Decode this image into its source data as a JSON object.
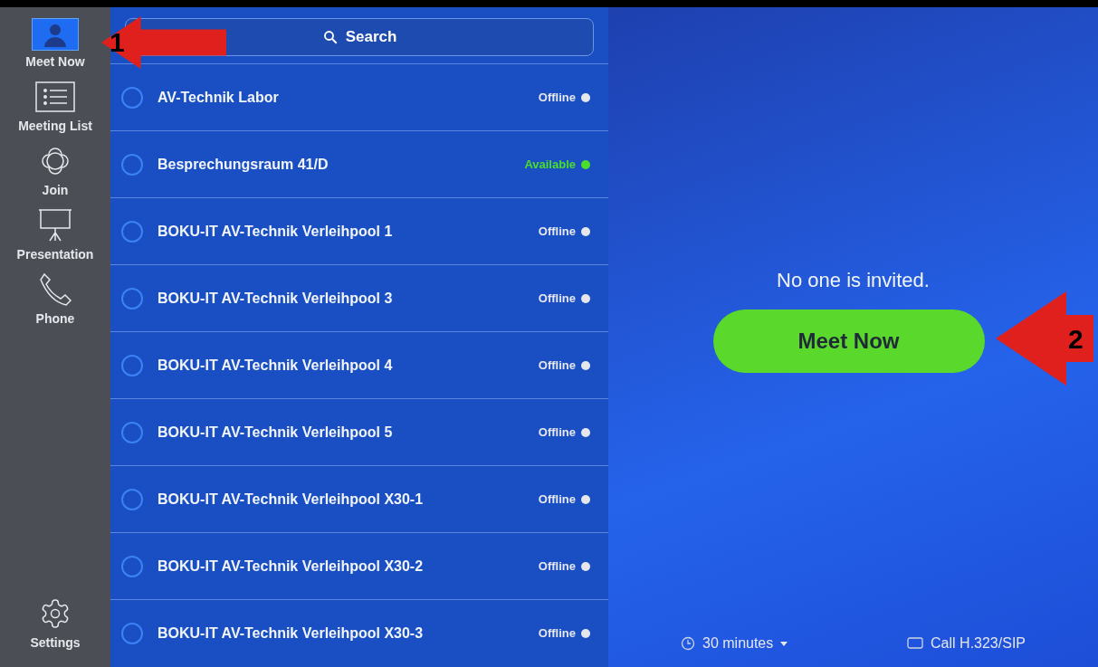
{
  "sidebar": {
    "items": [
      {
        "kind": "person",
        "label": "Meet Now",
        "selected": true
      },
      {
        "kind": "list",
        "label": "Meeting List",
        "selected": false
      },
      {
        "kind": "join",
        "label": "Join",
        "selected": false
      },
      {
        "kind": "presentation",
        "label": "Presentation",
        "selected": false
      },
      {
        "kind": "phone",
        "label": "Phone",
        "selected": false
      }
    ],
    "settings": {
      "kind": "settings",
      "label": "Settings",
      "selected": false
    }
  },
  "search": {
    "placeholder": "Search"
  },
  "rooms": [
    {
      "name": "AV-Technik Labor",
      "status": "Offline",
      "color": "#e5e7eb",
      "selected": false
    },
    {
      "name": "Besprechungsraum 41/D",
      "status": "Available",
      "color": "#4ade2a",
      "selected": false
    },
    {
      "name": "BOKU-IT AV-Technik Verleihpool 1",
      "status": "Offline",
      "color": "#e5e7eb",
      "selected": false
    },
    {
      "name": "BOKU-IT AV-Technik Verleihpool 3",
      "status": "Offline",
      "color": "#e5e7eb",
      "selected": false
    },
    {
      "name": "BOKU-IT AV-Technik Verleihpool 4",
      "status": "Offline",
      "color": "#e5e7eb",
      "selected": false
    },
    {
      "name": "BOKU-IT AV-Technik Verleihpool 5",
      "status": "Offline",
      "color": "#e5e7eb",
      "selected": false
    },
    {
      "name": "BOKU-IT AV-Technik Verleihpool X30-1",
      "status": "Offline",
      "color": "#e5e7eb",
      "selected": false
    },
    {
      "name": "BOKU-IT AV-Technik Verleihpool X30-2",
      "status": "Offline",
      "color": "#e5e7eb",
      "selected": false
    },
    {
      "name": "BOKU-IT AV-Technik Verleihpool X30-3",
      "status": "Offline",
      "color": "#e5e7eb",
      "selected": false
    }
  ],
  "panel": {
    "message": "No one is invited.",
    "button": "Meet Now",
    "duration": "30 minutes",
    "call": "Call H.323/SIP"
  },
  "annotations": [
    {
      "label": "1"
    },
    {
      "label": "2"
    }
  ]
}
